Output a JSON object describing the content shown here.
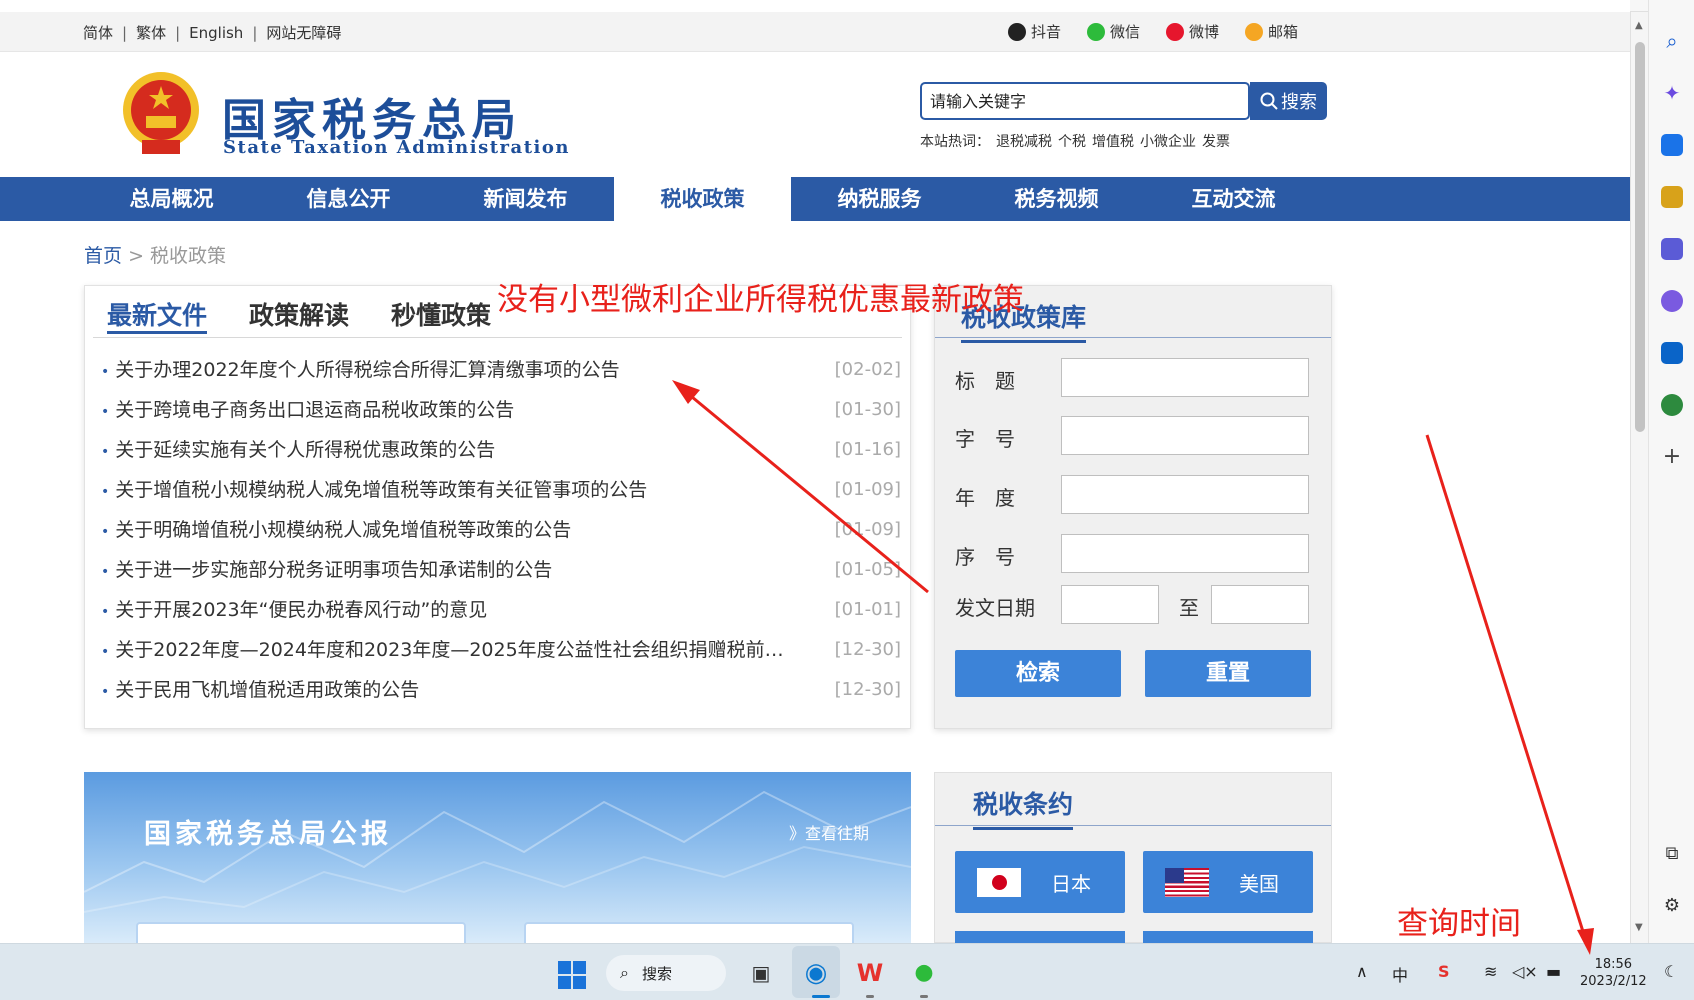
{
  "top_links": {
    "lang": [
      "简体",
      "繁体",
      "English",
      "网站无障碍"
    ],
    "social": [
      {
        "label": "抖音",
        "icon": "douyin-icon",
        "color": "#222222"
      },
      {
        "label": "微信",
        "icon": "wechat-icon",
        "color": "#2dbb3b"
      },
      {
        "label": "微博",
        "icon": "weibo-icon",
        "color": "#e6162d"
      },
      {
        "label": "邮箱",
        "icon": "mail-icon",
        "color": "#f5a623"
      }
    ]
  },
  "header": {
    "logo_cn": "国家税务总局",
    "logo_en": "State Taxation Administration",
    "search_placeholder": "请输入关键字",
    "search_button": "搜索",
    "hot_label": "本站热词：",
    "hot_words": [
      "退税减税",
      "个税",
      "增值税",
      "小微企业",
      "发票"
    ]
  },
  "nav": {
    "items": [
      "总局概况",
      "信息公开",
      "新闻发布",
      "税收政策",
      "纳税服务",
      "税务视频",
      "互动交流"
    ],
    "active_index": 3
  },
  "breadcrumb": {
    "home": "首页",
    "sep": ">",
    "current": "税收政策"
  },
  "policy_list": {
    "tabs": [
      "最新文件",
      "政策解读",
      "秒懂政策"
    ],
    "items": [
      {
        "title": "关于办理2022年度个人所得税综合所得汇算清缴事项的公告",
        "date": "[02-02]"
      },
      {
        "title": "关于跨境电子商务出口退运商品税收政策的公告",
        "date": "[01-30]"
      },
      {
        "title": "关于延续实施有关个人所得税优惠政策的公告",
        "date": "[01-16]"
      },
      {
        "title": "关于增值税小规模纳税人减免增值税等政策有关征管事项的公告",
        "date": "[01-09]"
      },
      {
        "title": "关于明确增值税小规模纳税人减免增值税等政策的公告",
        "date": "[01-09]"
      },
      {
        "title": "关于进一步实施部分税务证明事项告知承诺制的公告",
        "date": "[01-05]"
      },
      {
        "title": "关于开展2023年“便民办税春风行动”的意见",
        "date": "[01-01]"
      },
      {
        "title": "关于2022年度—2024年度和2023年度—2025年度公益性社会组织捐赠税前…",
        "date": "[12-30]"
      },
      {
        "title": "关于民用飞机增值税适用政策的公告",
        "date": "[12-30]"
      }
    ]
  },
  "policy_db": {
    "title": "税收政策库",
    "fields": [
      "标　题",
      "字　号",
      "年　度",
      "序　号"
    ],
    "date_label": "发文日期",
    "date_to": "至",
    "search_button": "检索",
    "reset_button": "重置"
  },
  "gazette": {
    "title": "国家税务总局公报",
    "more": "》查看往期"
  },
  "treaty": {
    "title": "税收条约",
    "countries": [
      "日本",
      "美国"
    ]
  },
  "taskbar": {
    "search": "搜索",
    "clock_time": "18:56",
    "clock_date": "2023/2/12",
    "ime": "中",
    "apps": [
      "start-icon",
      "file-explorer-icon",
      "edge-icon",
      "wps-icon",
      "wechat-icon"
    ]
  },
  "annotations": {
    "note_policy": "没有小型微利企业所得税优惠最新政策",
    "note_time": "查询时间",
    "color": "#e8211b"
  },
  "colors": {
    "brand_blue": "#2b5aa5",
    "button_blue": "#3c83d8",
    "date_gray": "#aaaaaa"
  }
}
